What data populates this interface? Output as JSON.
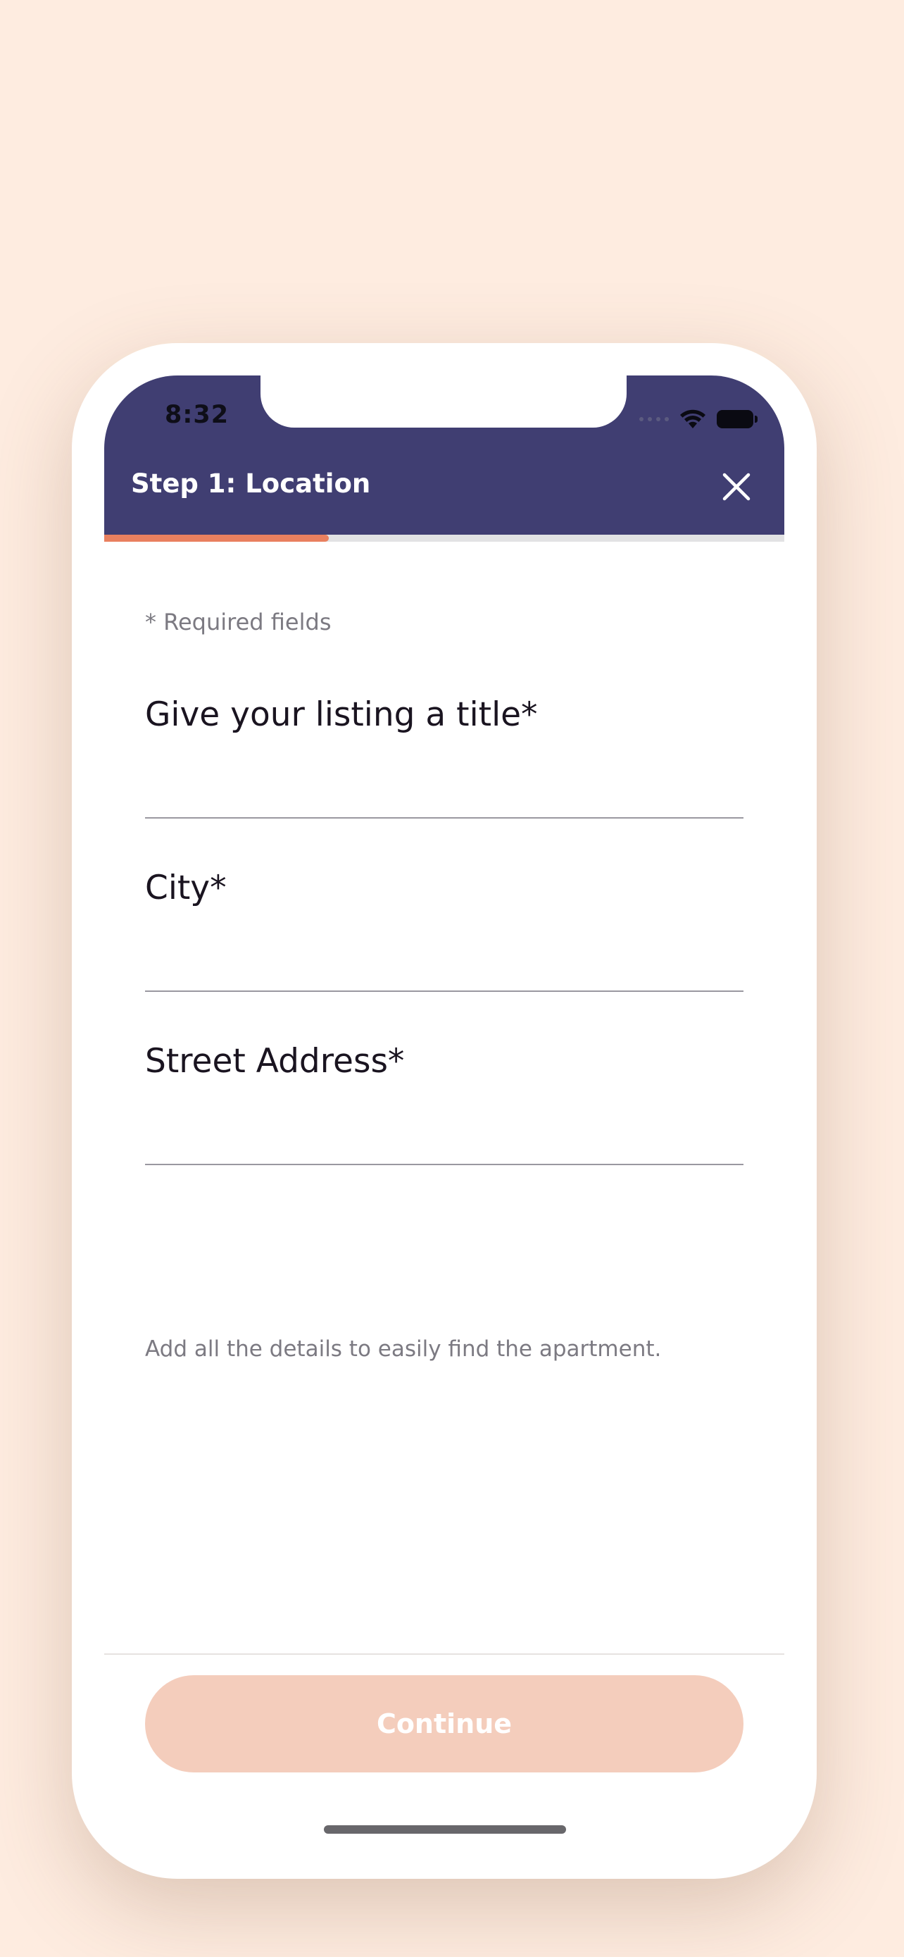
{
  "status_bar": {
    "time": "8:32"
  },
  "header": {
    "title": "Step 1: Location",
    "close_icon": "close-icon",
    "background": "#403e72"
  },
  "progress": {
    "fraction": 0.33,
    "color": "#e9805f"
  },
  "form": {
    "required_note": "* Required fields",
    "fields": [
      {
        "label": "Give your listing a title*",
        "value": ""
      },
      {
        "label": "City*",
        "value": ""
      },
      {
        "label": "Street Address*",
        "value": ""
      }
    ],
    "hint": "Add all the details to easily find the apartment."
  },
  "footer": {
    "continue_label": "Continue",
    "continue_color": "#f4cdbc"
  },
  "colors": {
    "page_background": "#feece0",
    "accent": "#e9805f"
  }
}
